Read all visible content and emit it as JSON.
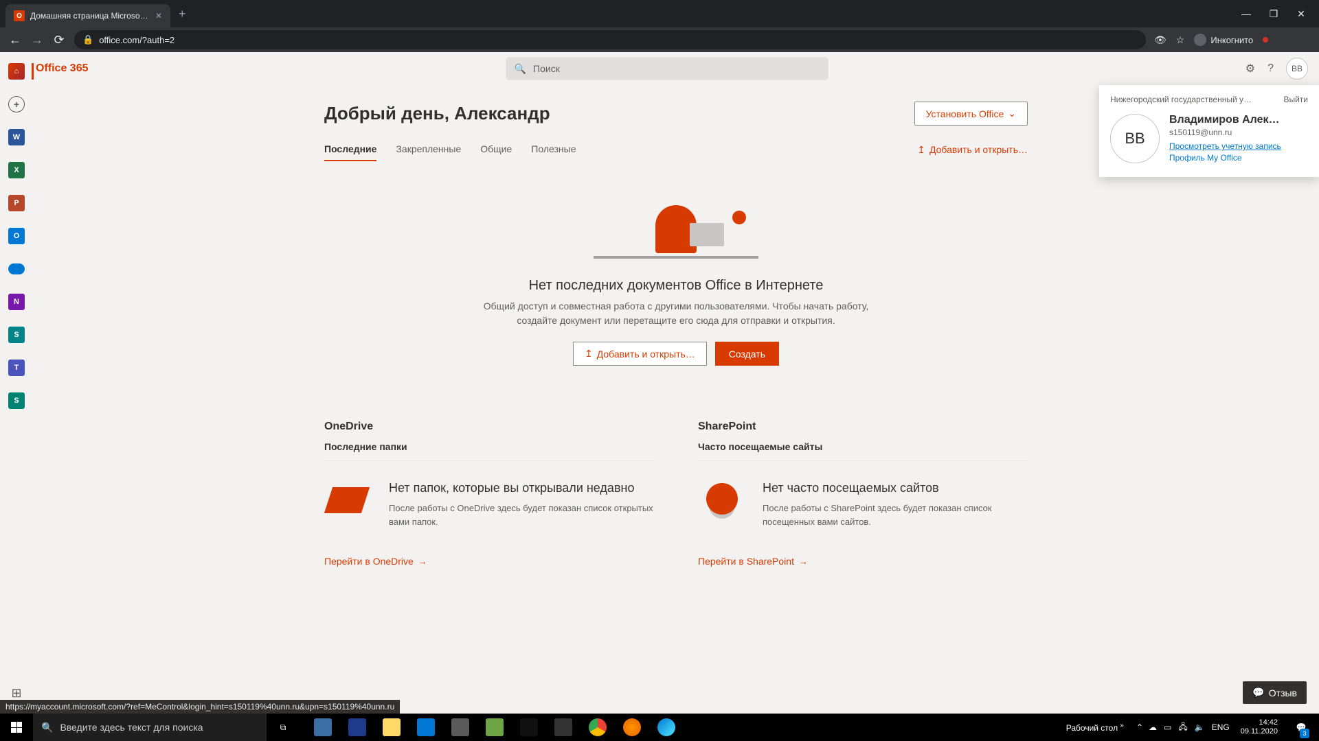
{
  "browser": {
    "tab_title": "Домашняя страница Microsoft O",
    "url_lock": "🔒",
    "url": "office.com/?auth=2",
    "incognito_label": "Инкогнито"
  },
  "office_header": {
    "brand": "Office 365",
    "search_placeholder": "Поиск",
    "avatar_initials": "ВВ"
  },
  "greeting": "Добрый день, Александр",
  "install_label": "Установить Office",
  "tabs": [
    "Последние",
    "Закрепленные",
    "Общие",
    "Полезные"
  ],
  "add_open": "Добавить и открыть…",
  "empty": {
    "title": "Нет последних документов Office в Интернете",
    "text": "Общий доступ и совместная работа с другими пользователями. Чтобы начать работу, создайте документ или перетащите его сюда для отправки и открытия.",
    "btn_add": "Добавить и открыть…",
    "btn_create": "Создать"
  },
  "onedrive": {
    "title": "OneDrive",
    "sub": "Последние папки",
    "h": "Нет папок, которые вы открывали недавно",
    "p": "После работы с OneDrive здесь будет показан список открытых вами папок.",
    "link": "Перейти в OneDrive"
  },
  "sharepoint": {
    "title": "SharePoint",
    "sub": "Часто посещаемые сайты",
    "h": "Нет часто посещаемых сайтов",
    "p": "После работы с SharePoint здесь будет показан список посещенных вами сайтов.",
    "link": "Перейти в SharePoint"
  },
  "account": {
    "org": "Нижегородский государственный у…",
    "signout": "Выйти",
    "avatar": "ВВ",
    "name": "Владимиров Алек…",
    "email": "s150119@unn.ru",
    "link1": "Просмотреть учетную запись",
    "link2": "Профиль My Office"
  },
  "feedback": "Отзыв",
  "status_url": "https://myaccount.microsoft.com/?ref=MeControl&login_hint=s150119%40unn.ru&upn=s150119%40unn.ru",
  "taskbar": {
    "search_placeholder": "Введите здесь текст для поиска",
    "desktop": "Рабочий стол",
    "lang": "ENG",
    "time": "14:42",
    "date": "09.11.2020",
    "notif_count": "3"
  }
}
